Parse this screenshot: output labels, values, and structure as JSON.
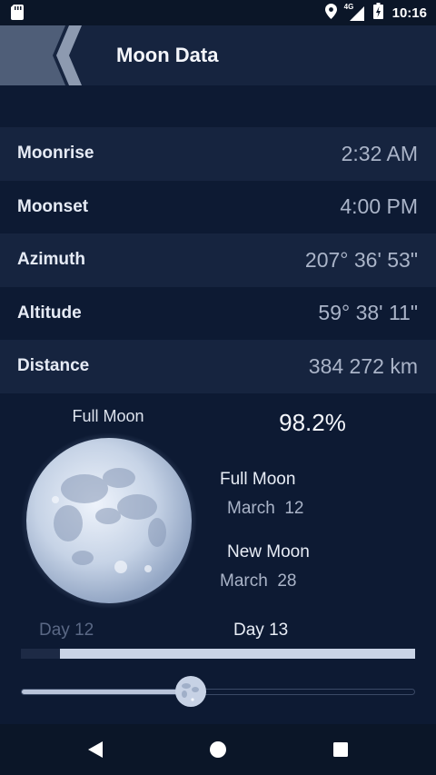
{
  "status_bar": {
    "network": "4G",
    "time": "10:16"
  },
  "toolbar": {
    "title": "Moon Data"
  },
  "rows": [
    {
      "label": "Moonrise",
      "value": "2:32 AM"
    },
    {
      "label": "Moonset",
      "value": "4:00 PM"
    },
    {
      "label": "Azimuth",
      "value": "207° 36' 53\""
    },
    {
      "label": "Altitude",
      "value": "59° 38' 11\""
    },
    {
      "label": "Distance",
      "value": "384 272 km"
    }
  ],
  "moon": {
    "phase_name": "Full Moon",
    "illumination": "98.2%"
  },
  "next_phases": {
    "full": {
      "title": "Full Moon",
      "date": "March  12"
    },
    "new": {
      "title": "New Moon",
      "date": "March  28"
    }
  },
  "days": {
    "previous": "Day 12",
    "current": "Day 13"
  },
  "day_progress": 0.9,
  "cycle_slider": 0.43,
  "colors": {
    "background": "#0d1a33",
    "row_alt": "#16243f",
    "accent": "#c9d3e6"
  }
}
